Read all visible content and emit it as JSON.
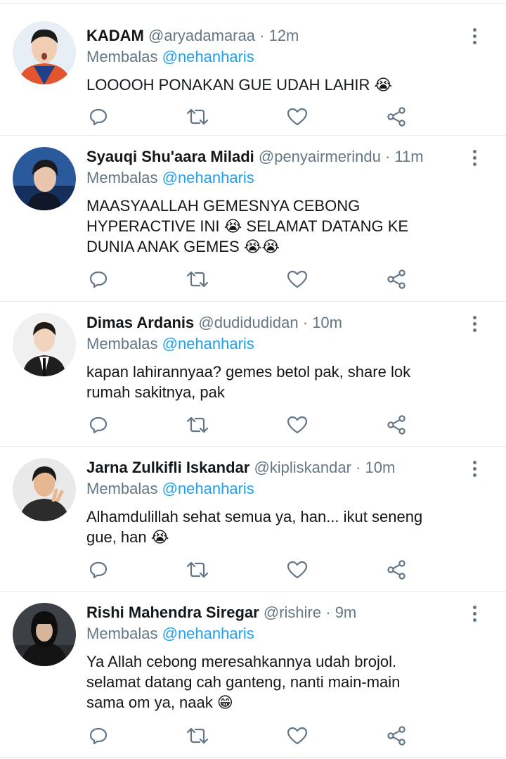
{
  "colors": {
    "text": "#14171a",
    "muted": "#657786",
    "link": "#1da1f2",
    "divider": "#e6ecf0"
  },
  "icons": {
    "reply": "reply-icon",
    "retweet": "retweet-icon",
    "like": "heart-icon",
    "share": "share-icon",
    "more": "more-vertical-icon"
  },
  "tweets": [
    {
      "name": "KADAM",
      "handle": "@aryadamaraa",
      "dot": "·",
      "time": "12m",
      "reply_prefix": "Membalas",
      "reply_to": "@nehanharis",
      "lines": [
        "LOOOOH PONAKAN GUE UDAH LAHIR 😭"
      ],
      "avatar_color": "#e8eef5"
    },
    {
      "name": "Syauqi Shu'aara Miladi",
      "handle": "@penyairmerindu",
      "dot": "·",
      "time": "11m",
      "reply_prefix": "Membalas",
      "reply_to": "@nehanharis",
      "lines": [
        "MAASYAALLAH GEMESNYA CEBONG",
        "HYPERACTIVE INI 😭 SELAMAT DATANG KE",
        "DUNIA ANAK GEMES 😭😭"
      ],
      "avatar_color": "#2a5a9c"
    },
    {
      "name": "Dimas Ardanis",
      "handle": "@dudidudidan",
      "dot": "·",
      "time": "10m",
      "reply_prefix": "Membalas",
      "reply_to": "@nehanharis",
      "lines": [
        "kapan lahirannyaa? gemes betol pak, share lok",
        "rumah sakitnya, pak"
      ],
      "avatar_color": "#f0f0f0"
    },
    {
      "name": "Jarna Zulkifli Iskandar",
      "handle": "@kipliskandar",
      "dot": "·",
      "time": "10m",
      "reply_prefix": "Membalas",
      "reply_to": "@nehanharis",
      "lines": [
        "Alhamdulillah sehat semua ya, han... ikut seneng",
        "gue, han 😭"
      ],
      "avatar_color": "#e9e9e9"
    },
    {
      "name": "Rishi Mahendra Siregar",
      "handle": "@rishire",
      "dot": "·",
      "time": "9m",
      "reply_prefix": "Membalas",
      "reply_to": "@nehanharis",
      "lines": [
        "Ya Allah cebong meresahkannya udah brojol.",
        "selamat datang cah ganteng, nanti main-main",
        "sama om ya, naak 😁"
      ],
      "avatar_color": "#3d4046"
    }
  ]
}
